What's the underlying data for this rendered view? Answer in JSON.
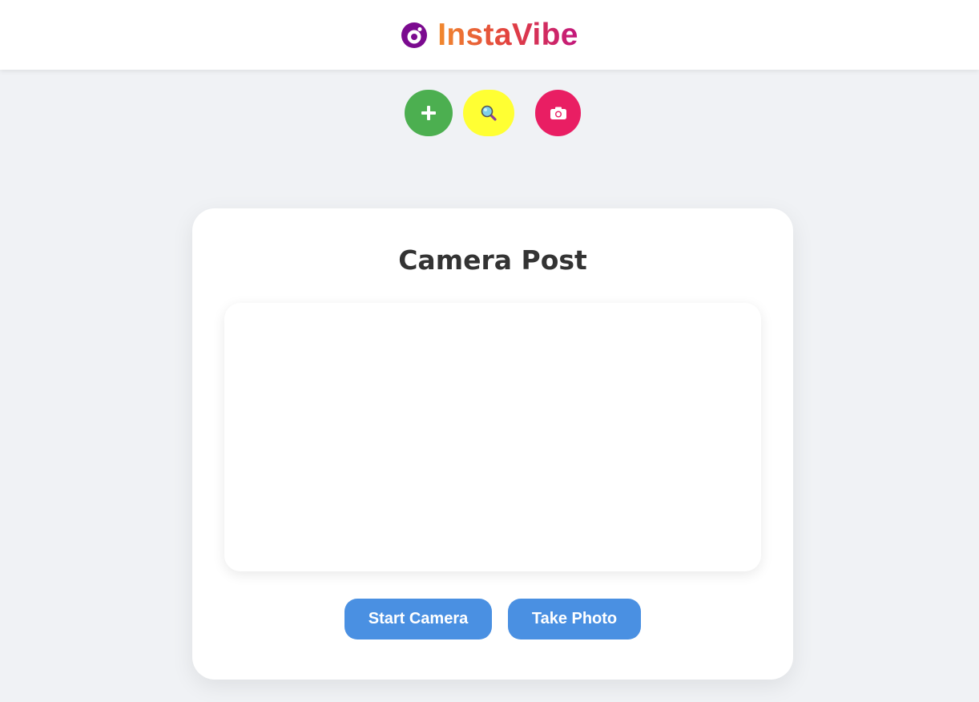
{
  "header": {
    "app_name": "InstaVibe",
    "logo_icon": "camera-lens-icon",
    "brand_gradient": [
      "#f18a2e",
      "#e2413f",
      "#c2177d"
    ]
  },
  "actions": [
    {
      "icon": "plus-icon",
      "color": "#4caf50"
    },
    {
      "icon": "search-icon",
      "color": "#ffff33"
    },
    {
      "icon": "camera-icon",
      "color": "#e91e63"
    }
  ],
  "card": {
    "title": "Camera Post",
    "start_camera_label": "Start Camera",
    "take_photo_label": "Take Photo",
    "button_color": "#4a90e2"
  }
}
